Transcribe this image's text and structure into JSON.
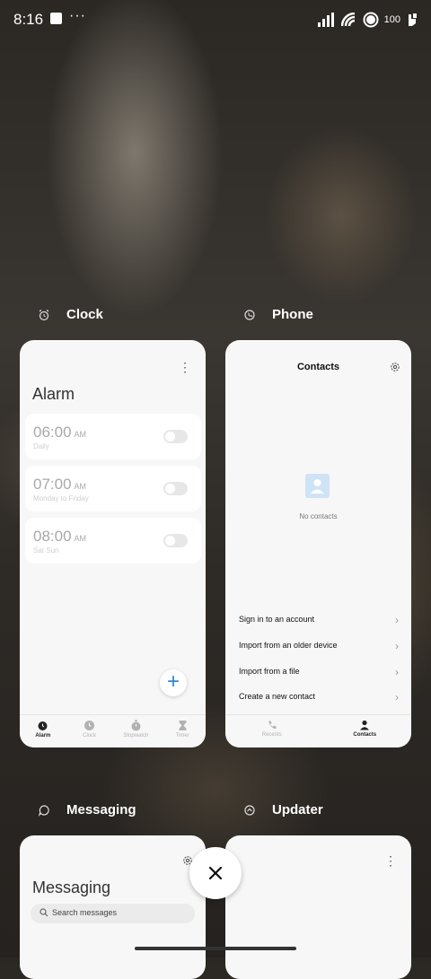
{
  "status_bar": {
    "time": "8:16",
    "battery": "100",
    "more": "···"
  },
  "apps": [
    {
      "name": "Clock",
      "icon": "alarm-clock-icon"
    },
    {
      "name": "Phone",
      "icon": "phone-icon"
    },
    {
      "name": "Messaging",
      "icon": "message-icon"
    },
    {
      "name": "Updater",
      "icon": "updater-icon"
    }
  ],
  "clock_card": {
    "title": "Alarm",
    "more": "⋮",
    "alarms": [
      {
        "time": "06:00",
        "ampm": "AM",
        "repeat": "Daily",
        "enabled": false
      },
      {
        "time": "07:00",
        "ampm": "AM",
        "repeat": "Monday to Friday",
        "enabled": false
      },
      {
        "time": "08:00",
        "ampm": "AM",
        "repeat": "Sat Sun",
        "enabled": false
      }
    ],
    "fab": "+",
    "nav": [
      {
        "label": "Alarm",
        "active": true
      },
      {
        "label": "Clock",
        "active": false
      },
      {
        "label": "Stopwatch",
        "active": false
      },
      {
        "label": "Timer",
        "active": false
      }
    ]
  },
  "phone_card": {
    "title": "Contacts",
    "empty_text": "No contacts",
    "actions": [
      "Sign in to an account",
      "Import from an older device",
      "Import from a file",
      "Create a new contact"
    ],
    "chevron": "›",
    "nav": [
      {
        "label": "Recents",
        "active": false
      },
      {
        "label": "Contacts",
        "active": true
      }
    ]
  },
  "messaging_card": {
    "title": "Messaging",
    "search_placeholder": "Search messages"
  },
  "updater_card": {
    "more": "⋮"
  },
  "colors": {
    "accent": "#2f86d8",
    "card_bg": "#f7f7f7"
  }
}
